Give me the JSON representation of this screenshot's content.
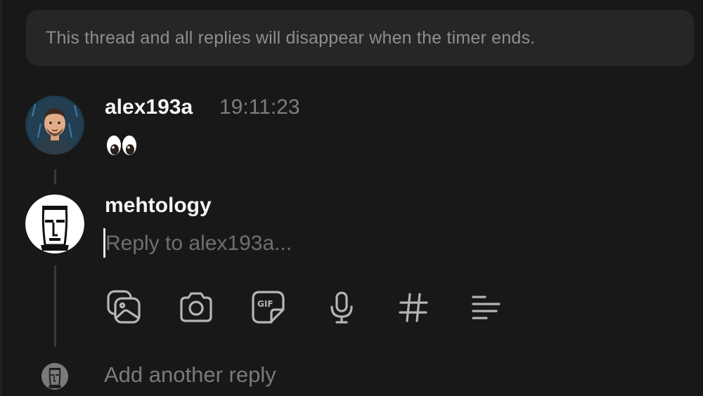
{
  "banner": {
    "text": "This thread and all replies will disappear when the timer ends."
  },
  "original_post": {
    "username": "alex193a",
    "timestamp": "19:11:23",
    "content_emoji": "eyes-emoji"
  },
  "reply_composer": {
    "username": "mehtology",
    "placeholder": "Reply to alex193a...",
    "value": "",
    "toolbar": [
      {
        "icon": "photo-library-icon"
      },
      {
        "icon": "camera-icon"
      },
      {
        "icon": "gif-sticker-icon"
      },
      {
        "icon": "microphone-icon"
      },
      {
        "icon": "hashtag-icon"
      },
      {
        "icon": "more-lines-icon"
      }
    ]
  },
  "footer": {
    "add_reply_label": "Add another reply"
  },
  "colors": {
    "background": "#181818",
    "banner_bg": "#262626",
    "muted_text": "#8e8e8e",
    "icon": "#b5b5b5"
  }
}
